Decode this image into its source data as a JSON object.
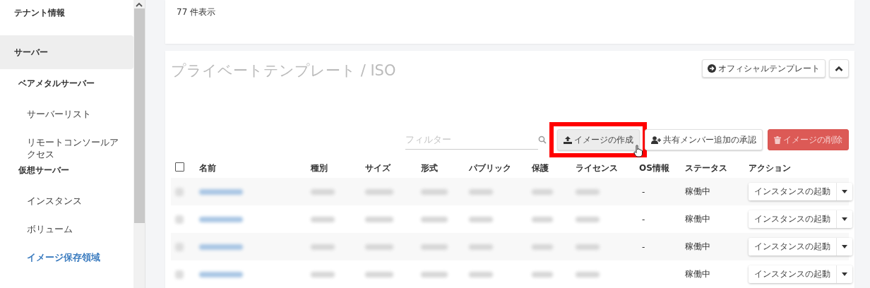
{
  "sidebar": {
    "items": [
      {
        "label": "テナント情報",
        "selected": false
      },
      {
        "label": "サーバー",
        "selected": true,
        "children": [
          {
            "label": "ベアメタルサーバー",
            "selected": false,
            "children": [
              {
                "label": "サーバーリスト",
                "selected": false
              },
              {
                "label": "リモートコンソールアクセス",
                "selected": false
              }
            ]
          },
          {
            "label": "仮想サーバー",
            "selected": false,
            "children": [
              {
                "label": "インスタンス",
                "selected": false
              },
              {
                "label": "ボリューム",
                "selected": false
              },
              {
                "label": "イメージ保存領域",
                "selected": true
              }
            ]
          }
        ]
      }
    ]
  },
  "summary": {
    "count_text": "77 件表示"
  },
  "panel": {
    "title": "プライベートテンプレート / ISO",
    "official_button": "オフィシャルテンプレート",
    "filter": {
      "placeholder": "フィルター"
    },
    "buttons": [
      {
        "kind": "upload",
        "label": "イメージの作成",
        "disabled": false,
        "highlighted": true,
        "hovered": true
      },
      {
        "kind": "member",
        "label": "共有メンバー追加の承認",
        "disabled": false,
        "highlighted": false,
        "hovered": false
      },
      {
        "kind": "delete",
        "label": "イメージの削除",
        "disabled": true,
        "highlighted": false,
        "hovered": false
      }
    ],
    "table": {
      "select_all": {
        "checked": false
      },
      "columns": [
        "名前",
        "種別",
        "サイズ",
        "形式",
        "パブリック",
        "保護",
        "ライセンス",
        "OS情報",
        "ステータス",
        "アクション"
      ],
      "rows": [
        {
          "redacted": true,
          "os_info": "-",
          "status": "稼働中",
          "action": "インスタンスの起動"
        },
        {
          "redacted": true,
          "os_info": "-",
          "status": "稼働中",
          "action": "インスタンスの起動"
        },
        {
          "redacted": true,
          "os_info": "-",
          "status": "稼働中",
          "action": "インスタンスの起動"
        },
        {
          "redacted": true,
          "os_info": "",
          "status": "稼働中",
          "action": "インスタンスの起動"
        }
      ]
    }
  }
}
